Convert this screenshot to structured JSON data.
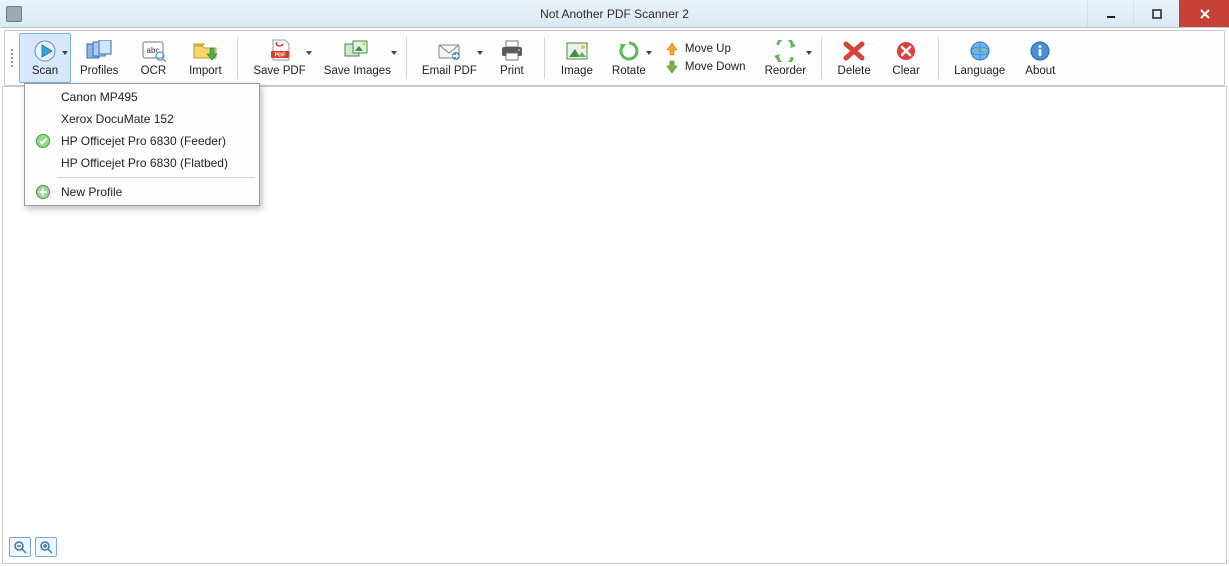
{
  "window": {
    "title": "Not Another PDF Scanner 2"
  },
  "toolbar": {
    "scan": "Scan",
    "profiles": "Profiles",
    "ocr": "OCR",
    "import": "Import",
    "save_pdf": "Save PDF",
    "save_images": "Save Images",
    "email_pdf": "Email PDF",
    "print": "Print",
    "image": "Image",
    "rotate": "Rotate",
    "move_up": "Move Up",
    "move_down": "Move Down",
    "reorder": "Reorder",
    "delete": "Delete",
    "clear": "Clear",
    "language": "Language",
    "about": "About"
  },
  "scan_menu": {
    "items": [
      {
        "label": "Canon MP495",
        "checked": false
      },
      {
        "label": "Xerox DocuMate 152",
        "checked": false
      },
      {
        "label": "HP Officejet Pro 6830 (Feeder)",
        "checked": true
      },
      {
        "label": "HP Officejet Pro 6830 (Flatbed)",
        "checked": false
      }
    ],
    "new_profile": "New Profile"
  }
}
